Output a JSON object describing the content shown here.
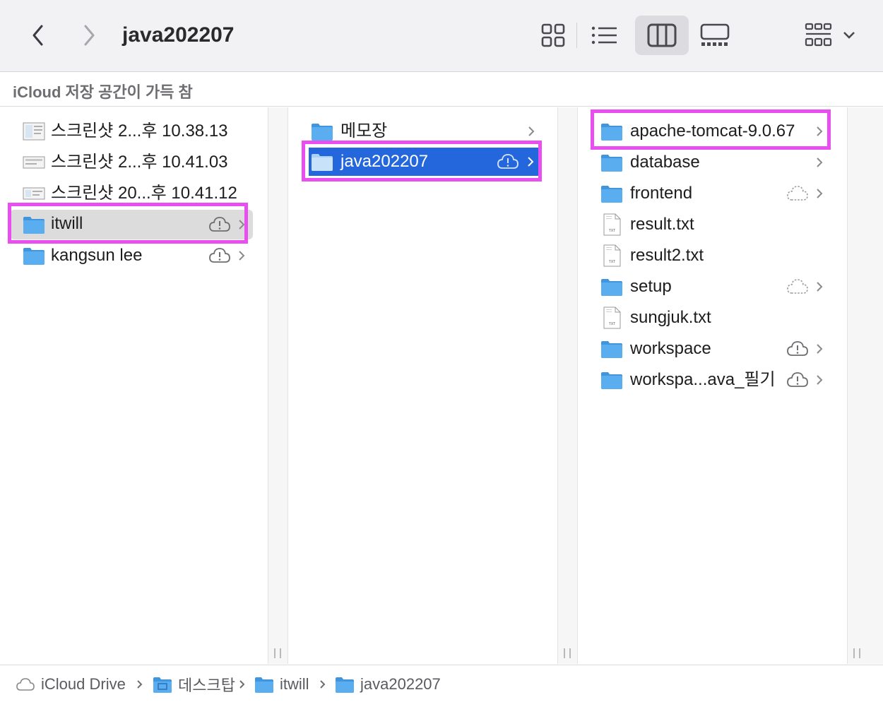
{
  "window": {
    "title": "java202207"
  },
  "toolbar": {
    "back_icon": "chevron-left-icon",
    "forward_icon": "chevron-right-icon",
    "views": [
      {
        "name": "icon-view",
        "icon": "grid-icon",
        "active": false
      },
      {
        "name": "list-view",
        "icon": "list-icon",
        "active": false
      },
      {
        "name": "column-view",
        "icon": "columns-icon",
        "active": true
      },
      {
        "name": "gallery-view",
        "icon": "gallery-icon",
        "active": false
      }
    ],
    "group_icon": "group-icon"
  },
  "banner": {
    "text": "iCloud 저장 공간이 가득 참"
  },
  "columns": [
    {
      "items": [
        {
          "label": "스크린샷 2...후 10.38.13",
          "kind": "screenshot",
          "cloud": false,
          "chevron": false
        },
        {
          "label": "스크린샷 2...후 10.41.03",
          "kind": "screenshot",
          "cloud": false,
          "chevron": false
        },
        {
          "label": "스크린샷 20...후 10.41.12",
          "kind": "screenshot",
          "cloud": false,
          "chevron": false
        },
        {
          "label": "itwill",
          "kind": "folder",
          "cloud": "alert",
          "chevron": true,
          "selected": "gray"
        },
        {
          "label": "kangsun lee",
          "kind": "folder",
          "cloud": "alert",
          "chevron": true
        }
      ]
    },
    {
      "items": [
        {
          "label": "메모장",
          "kind": "folder",
          "cloud": false,
          "chevron": true
        },
        {
          "label": "java202207",
          "kind": "folder",
          "cloud": "alert",
          "chevron": true,
          "selected": "blue"
        }
      ]
    },
    {
      "items": [
        {
          "label": "apache-tomcat-9.0.67",
          "kind": "folder",
          "cloud": false,
          "chevron": true
        },
        {
          "label": "database",
          "kind": "folder",
          "cloud": false,
          "chevron": true
        },
        {
          "label": "frontend",
          "kind": "folder",
          "cloud": "dashed",
          "chevron": true
        },
        {
          "label": "result.txt",
          "kind": "txt",
          "cloud": false,
          "chevron": false
        },
        {
          "label": "result2.txt",
          "kind": "txt",
          "cloud": false,
          "chevron": false
        },
        {
          "label": "setup",
          "kind": "folder",
          "cloud": "dashed",
          "chevron": true
        },
        {
          "label": "sungjuk.txt",
          "kind": "txt",
          "cloud": false,
          "chevron": false
        },
        {
          "label": "workspace",
          "kind": "folder",
          "cloud": "alert",
          "chevron": true
        },
        {
          "label": "workspa...ava_필기",
          "kind": "folder",
          "cloud": "alert",
          "chevron": true
        }
      ]
    }
  ],
  "txt_badge": "TXT",
  "pathbar": {
    "crumbs": [
      {
        "label": "iCloud Drive",
        "icon": "cloud-icon"
      },
      {
        "label": "데스크탑",
        "icon": "desktop-folder-icon"
      },
      {
        "label": "itwill",
        "icon": "folder-icon"
      },
      {
        "label": "java202207",
        "icon": "folder-icon"
      }
    ]
  },
  "colors": {
    "folder": "#5aaef0",
    "folder_tab": "#3f95de",
    "selection_blue": "#2466dc",
    "selection_gray": "#dcdcdc",
    "highlight": "#e94ff0"
  }
}
